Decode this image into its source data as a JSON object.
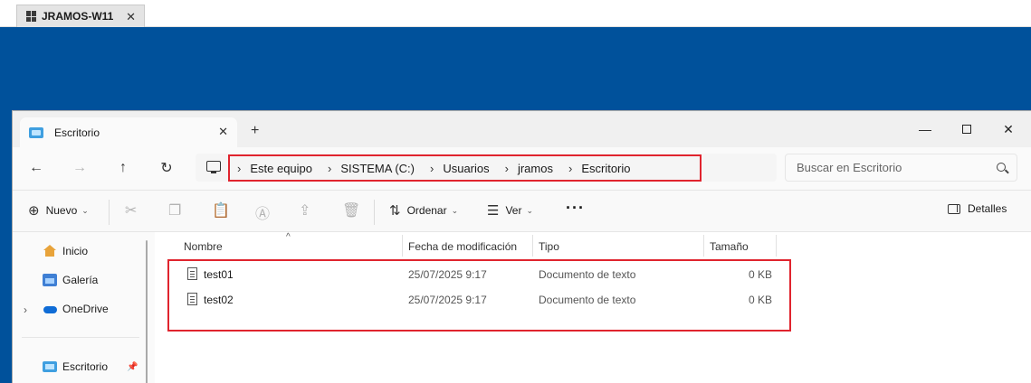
{
  "host": {
    "tab_title": "JRAMOS-W11",
    "close": "✕"
  },
  "window": {
    "tab_title": "Escritorio",
    "tab_close": "✕",
    "new_tab": "+",
    "minimize": "—",
    "close": "✕"
  },
  "nav_buttons": {
    "back": "←",
    "forward": "→",
    "up": "↑",
    "refresh": "↻"
  },
  "address": {
    "breadcrumbs": [
      "Este equipo",
      "SISTEMA (C:)",
      "Usuarios",
      "jramos",
      "Escritorio"
    ],
    "separator": "›"
  },
  "search": {
    "placeholder": "Buscar en Escritorio"
  },
  "command_bar": {
    "new_label": "Nuevo",
    "new_glyph": "⊕",
    "sort_label": "Ordenar",
    "sort_glyph": "⇅",
    "view_label": "Ver",
    "view_glyph": "☰",
    "more": "···",
    "details_label": "Detalles",
    "caret": "⌄",
    "icons": [
      "cut-icon",
      "copy-icon",
      "paste-icon",
      "rename-icon",
      "share-icon",
      "delete-icon"
    ]
  },
  "sidebar": {
    "items": [
      {
        "label": "Inicio",
        "icon": "home-icon"
      },
      {
        "label": "Galería",
        "icon": "gallery-icon"
      },
      {
        "label": "OneDrive",
        "icon": "onedrive-icon"
      },
      {
        "label": "Escritorio",
        "icon": "desktop-folder-icon"
      }
    ],
    "expand": "›",
    "pin": "📌"
  },
  "table": {
    "columns": [
      "Nombre",
      "Fecha de modificación",
      "Tipo",
      "Tamaño"
    ],
    "sort_indicator": "^",
    "rows": [
      {
        "name": "test01",
        "modified": "25/07/2025 9:17",
        "type": "Documento de texto",
        "size": "0 KB"
      },
      {
        "name": "test02",
        "modified": "25/07/2025 9:17",
        "type": "Documento de texto",
        "size": "0 KB"
      }
    ]
  },
  "colors": {
    "desktop": "#00519b",
    "highlight": "#e0242e",
    "accent": "#0f6cd6"
  }
}
